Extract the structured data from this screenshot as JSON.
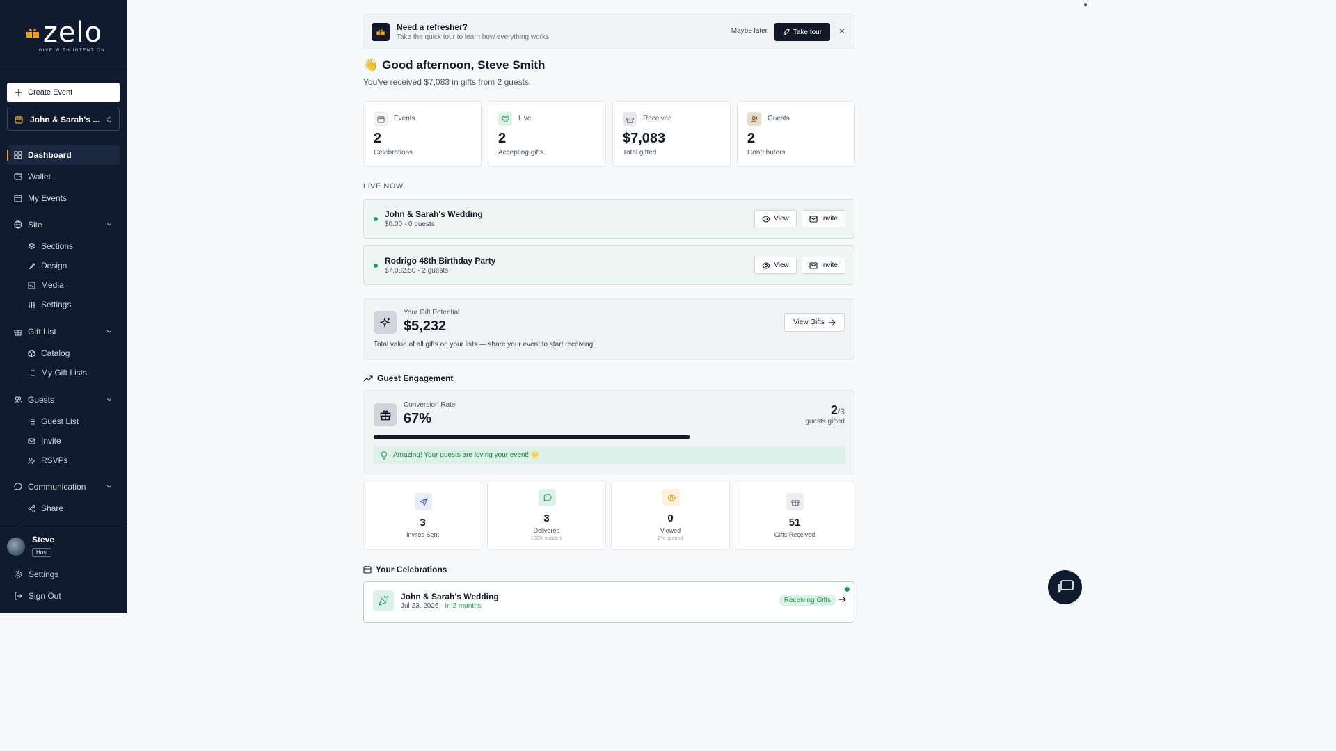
{
  "brand": {
    "name": "zelo",
    "tagline": "GIVE WITH INTENTION"
  },
  "sidebar": {
    "create_event": "Create Event",
    "event_selector": "John & Sarah's ...",
    "nav": {
      "dashboard": "Dashboard",
      "wallet": "Wallet",
      "my_events": "My Events",
      "site": "Site",
      "site_items": [
        "Sections",
        "Design",
        "Media",
        "Settings"
      ],
      "gift_list": "Gift List",
      "gift_items": [
        "Catalog",
        "My Gift Lists"
      ],
      "guests": "Guests",
      "guest_items": [
        "Guest List",
        "Invite",
        "RSVPs"
      ],
      "communication": "Communication",
      "communication_items": [
        "Share"
      ]
    },
    "user": {
      "name": "Steve",
      "role": "Host"
    },
    "settings": "Settings",
    "sign_out": "Sign Out"
  },
  "refresher": {
    "title": "Need a refresher?",
    "subtitle": "Take the quick tour to learn how everything works",
    "maybe_later": "Maybe later",
    "take_tour": "Take tour"
  },
  "greeting": {
    "emoji": "👋",
    "title": "Good afternoon, Steve Smith",
    "subtitle": "You've received $7,083 in gifts from 2 guests."
  },
  "stats": [
    {
      "label": "Events",
      "value": "2",
      "sub": "Celebrations"
    },
    {
      "label": "Live",
      "value": "2",
      "sub": "Accepting gifts"
    },
    {
      "label": "Received",
      "value": "$7,083",
      "sub": "Total gifted"
    },
    {
      "label": "Guests",
      "value": "2",
      "sub": "Contributors"
    }
  ],
  "live_now": {
    "heading": "LIVE NOW",
    "view_label": "View",
    "invite_label": "Invite",
    "events": [
      {
        "name": "John & Sarah's Wedding",
        "meta": "$0.00 · 0 guests"
      },
      {
        "name": "Rodrigo 48th Birthday Party",
        "meta": "$7,082.50 · 2 guests"
      }
    ]
  },
  "gift_potential": {
    "label": "Your Gift Potential",
    "value": "$5,232",
    "description": "Total value of all gifts on your lists — share your event to start receiving!",
    "button": "View Gifts"
  },
  "engagement": {
    "heading": "Guest Engagement",
    "conversion_label": "Conversion Rate",
    "conversion_value": "67%",
    "gifted_count": "2",
    "gifted_total": "/3",
    "gifted_note": "guests gifted",
    "progress": 0.67,
    "message": "Amazing! Your guests are loving your event! 🌟"
  },
  "metrics": [
    {
      "value": "3",
      "label": "Invites Sent",
      "sub": ""
    },
    {
      "value": "3",
      "label": "Delivered",
      "sub": "100% success"
    },
    {
      "value": "0",
      "label": "Viewed",
      "sub": "0% opened"
    },
    {
      "value": "51",
      "label": "Gifts Received",
      "sub": ""
    }
  ],
  "celebrations": {
    "heading": "Your Celebrations",
    "items": [
      {
        "name": "John & Sarah's Wedding",
        "date": "Jul 23, 2026",
        "relative": "In 2 months",
        "badge": "Receiving Gifts"
      }
    ]
  },
  "colors": {
    "sidebar": "#0f1a2e",
    "accent": "#f59e0b",
    "success": "#16a34a"
  }
}
